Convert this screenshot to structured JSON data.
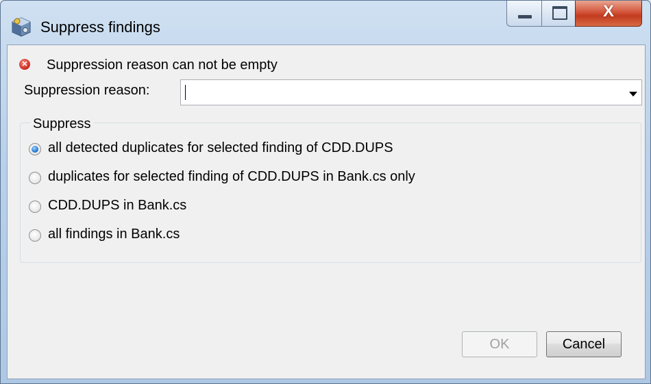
{
  "window": {
    "title": "Suppress findings",
    "icon": "cube-gear-icon",
    "controls": {
      "minimize": "minimize-icon",
      "maximize": "maximize-icon",
      "close_label": "X"
    }
  },
  "error": {
    "icon": "error-x-icon",
    "message": "Suppression reason can not be empty"
  },
  "reason": {
    "label": "Suppression reason:",
    "value": ""
  },
  "suppress": {
    "group_label": "Suppress",
    "options": [
      {
        "label": "all detected duplicates for selected finding of CDD.DUPS",
        "checked": true
      },
      {
        "label": "duplicates for selected finding of CDD.DUPS in Bank.cs only",
        "checked": false
      },
      {
        "label": "CDD.DUPS in Bank.cs",
        "checked": false
      },
      {
        "label": "all findings in Bank.cs",
        "checked": false
      }
    ]
  },
  "buttons": {
    "ok": "OK",
    "cancel": "Cancel"
  },
  "colors": {
    "titlebar": "#b9d1ea",
    "close_button": "#c13b1f",
    "dialog_bg": "#f0f0f0",
    "radio_selected": "#2a7ad6"
  }
}
